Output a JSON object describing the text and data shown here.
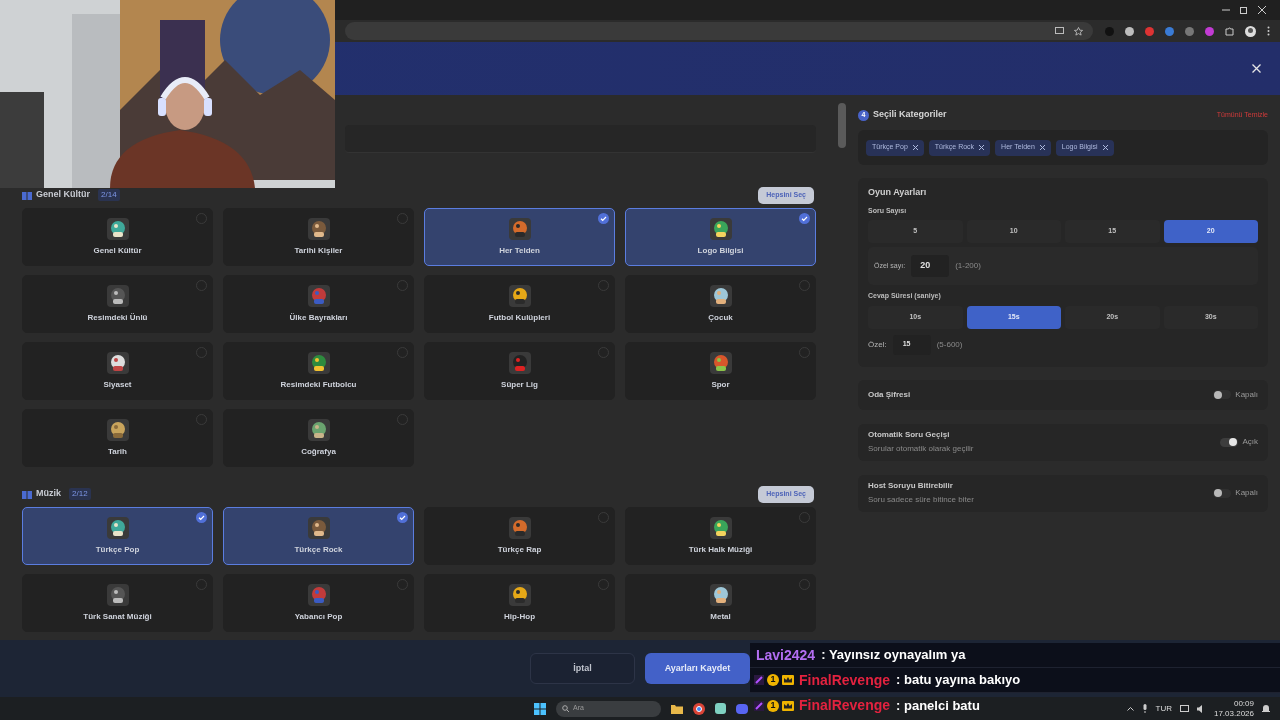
{
  "modal": {
    "categories": [
      {
        "title": "Genel Kültür",
        "count": "2/14",
        "select_all": "Hepsini Seç",
        "items": [
          {
            "label": "Genel Kültür",
            "selected": false
          },
          {
            "label": "Tarihi Kişiler",
            "selected": false
          },
          {
            "label": "Her Telden",
            "selected": true
          },
          {
            "label": "Logo Bilgisi",
            "selected": true
          },
          {
            "label": "Resimdeki Ünlü",
            "selected": false
          },
          {
            "label": "Ülke Bayrakları",
            "selected": false
          },
          {
            "label": "Futbol Kulüpleri",
            "selected": false
          },
          {
            "label": "Çocuk",
            "selected": false
          },
          {
            "label": "Siyaset",
            "selected": false
          },
          {
            "label": "Resimdeki Futbolcu",
            "selected": false
          },
          {
            "label": "Süper Lig",
            "selected": false
          },
          {
            "label": "Spor",
            "selected": false
          },
          {
            "label": "Tarih",
            "selected": false
          },
          {
            "label": "Coğrafya",
            "selected": false
          }
        ]
      },
      {
        "title": "Müzik",
        "count": "2/12",
        "select_all": "Hepsini Seç",
        "items": [
          {
            "label": "Türkçe Pop",
            "selected": true
          },
          {
            "label": "Türkçe Rock",
            "selected": true
          },
          {
            "label": "Türkçe Rap",
            "selected": false
          },
          {
            "label": "Türk Halk Müziği",
            "selected": false
          },
          {
            "label": "Türk Sanat Müziği",
            "selected": false
          },
          {
            "label": "Yabancı Pop",
            "selected": false
          },
          {
            "label": "Hip-Hop",
            "selected": false
          },
          {
            "label": "Metal",
            "selected": false
          }
        ]
      }
    ],
    "selected_panel": {
      "badge": "4",
      "title": "Seçili Kategoriler",
      "clear": "Tümünü Temizle",
      "chips": [
        "Türkçe Pop",
        "Türkçe Rock",
        "Her Telden",
        "Logo Bilgisi"
      ]
    },
    "game_settings": {
      "title": "Oyun Ayarları",
      "question_count": {
        "label": "Soru Sayısı",
        "options": [
          {
            "label": "5",
            "selected": false
          },
          {
            "label": "10",
            "selected": false
          },
          {
            "label": "15",
            "selected": false
          },
          {
            "label": "20",
            "selected": true
          }
        ],
        "custom_label": "Özel sayı:",
        "custom_value": "20",
        "custom_range": "(1-200)"
      },
      "answer_time": {
        "label": "Cevap Süresi (saniye)",
        "options": [
          {
            "label": "10s",
            "selected": false
          },
          {
            "label": "15s",
            "selected": true
          },
          {
            "label": "20s",
            "selected": false
          },
          {
            "label": "30s",
            "selected": false
          }
        ],
        "custom_label": "Özel:",
        "custom_value": "15",
        "custom_range": "(5-600)"
      }
    },
    "toggles": [
      {
        "title": "Oda Şifresi",
        "on": false,
        "state_label": "Kapalı"
      },
      {
        "title": "Otomatik Soru Geçişi",
        "subtitle": "Sorular otomatik olarak geçilir",
        "on": true,
        "state_label": "Açık"
      },
      {
        "title": "Host Soruyu Bitirebilir",
        "subtitle": "Soru sadece süre bitince biter",
        "on": false,
        "state_label": "Kapalı"
      }
    ],
    "footer": {
      "cancel": "İptal",
      "save": "Ayarları Kaydet"
    }
  },
  "chat": [
    {
      "user": "Lavi2424",
      "color": "#b36ef2",
      "text": ": Yayınsız oynayalım ya"
    },
    {
      "user": "FinalRevenge",
      "color": "#e3223f",
      "badge": "1",
      "text": ": batu yayına bakıyo"
    },
    {
      "user": "FinalRevenge",
      "color": "#e3223f",
      "badge": "1",
      "text": ": panelci batu"
    }
  ],
  "taskbar": {
    "search_placeholder": "Ara",
    "language": "TUR",
    "time": "00:09",
    "date": "17.03.2026"
  }
}
